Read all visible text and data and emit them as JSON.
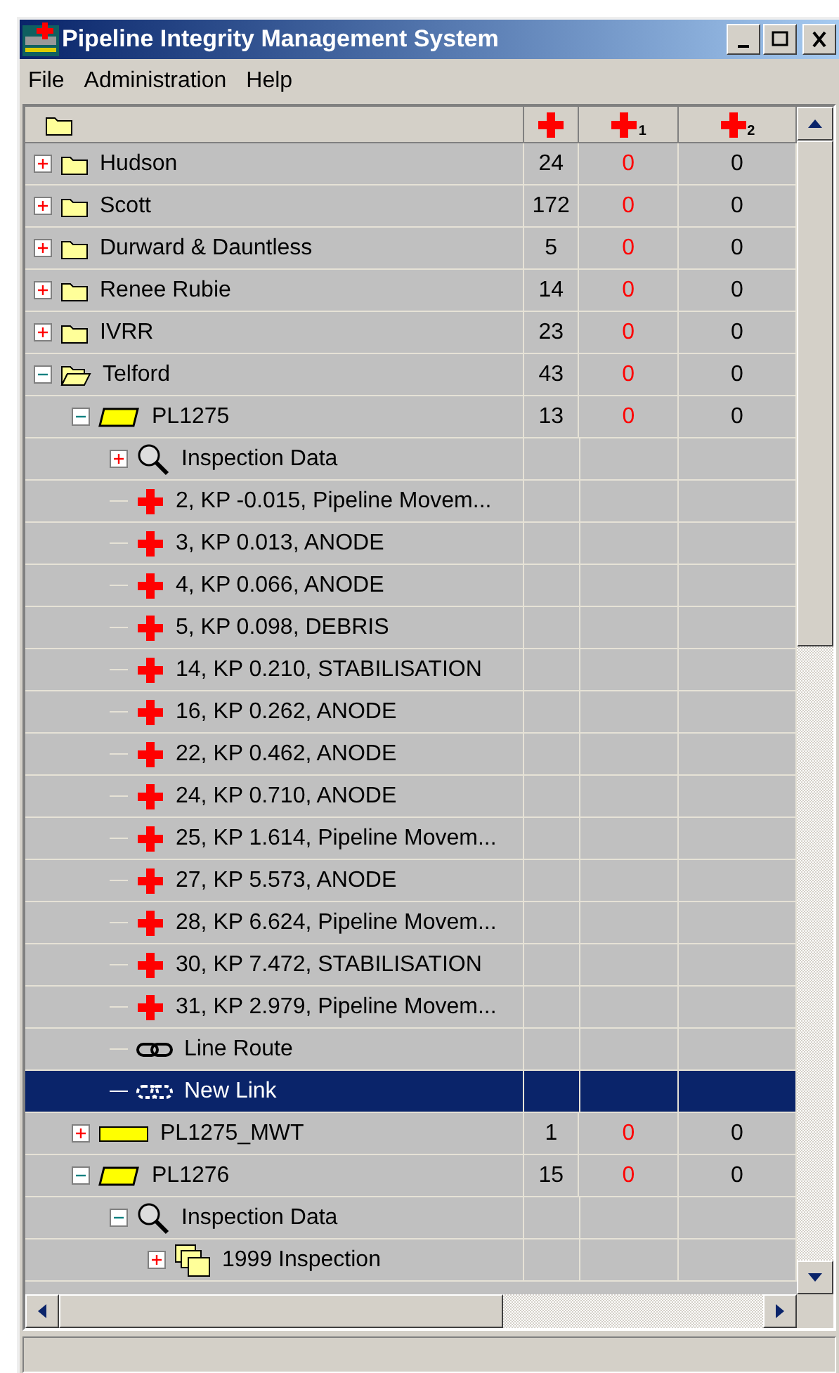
{
  "window": {
    "title": "Pipeline Integrity Management System"
  },
  "menu": [
    "File",
    "Administration",
    "Help"
  ],
  "columns": [
    {
      "kind": "total"
    },
    {
      "kind": "level",
      "subscript": "1"
    },
    {
      "kind": "level",
      "subscript": "2"
    }
  ],
  "tree": [
    {
      "kind": "folder",
      "label": "Hudson",
      "expanded": false,
      "selected": false,
      "total": "24",
      "c1": "0",
      "c2": "0"
    },
    {
      "kind": "folder",
      "label": "Scott",
      "expanded": false,
      "selected": false,
      "total": "172",
      "c1": "0",
      "c2": "0"
    },
    {
      "kind": "folder",
      "label": "Durward & Dauntless",
      "expanded": false,
      "selected": false,
      "total": "5",
      "c1": "0",
      "c2": "0"
    },
    {
      "kind": "folder",
      "label": "Renee Rubie",
      "expanded": false,
      "selected": false,
      "total": "14",
      "c1": "0",
      "c2": "0"
    },
    {
      "kind": "folder",
      "label": "IVRR",
      "expanded": false,
      "selected": false,
      "total": "23",
      "c1": "0",
      "c2": "0"
    },
    {
      "kind": "folder",
      "label": "Telford",
      "expanded": true,
      "selected": false,
      "total": "43",
      "c1": "0",
      "c2": "0",
      "children": [
        {
          "kind": "pipeline",
          "label": "PL1275",
          "expanded": true,
          "selected": false,
          "total": "13",
          "c1": "0",
          "c2": "0",
          "children": [
            {
              "kind": "inspection",
              "label": "Inspection Data",
              "expanded": false,
              "selected": false
            },
            {
              "kind": "anomaly",
              "label": "2, KP -0.015, Pipeline Movem...",
              "selected": false
            },
            {
              "kind": "anomaly",
              "label": "3, KP 0.013, ANODE",
              "selected": false
            },
            {
              "kind": "anomaly",
              "label": "4, KP 0.066, ANODE",
              "selected": false
            },
            {
              "kind": "anomaly",
              "label": "5, KP 0.098, DEBRIS",
              "selected": false
            },
            {
              "kind": "anomaly",
              "label": "14, KP 0.210, STABILISATION",
              "selected": false
            },
            {
              "kind": "anomaly",
              "label": "16, KP 0.262, ANODE",
              "selected": false
            },
            {
              "kind": "anomaly",
              "label": "22, KP 0.462, ANODE",
              "selected": false
            },
            {
              "kind": "anomaly",
              "label": "24, KP 0.710, ANODE",
              "selected": false
            },
            {
              "kind": "anomaly",
              "label": "25, KP 1.614, Pipeline Movem...",
              "selected": false
            },
            {
              "kind": "anomaly",
              "label": "27, KP 5.573, ANODE",
              "selected": false
            },
            {
              "kind": "anomaly",
              "label": "28, KP 6.624, Pipeline Movem...",
              "selected": false
            },
            {
              "kind": "anomaly",
              "label": "30, KP 7.472, STABILISATION",
              "selected": false
            },
            {
              "kind": "anomaly",
              "label": "31, KP 2.979, Pipeline Movem...",
              "selected": false
            },
            {
              "kind": "link",
              "label": "Line Route",
              "selected": false
            },
            {
              "kind": "new-link",
              "label": "New Link",
              "selected": true
            }
          ]
        },
        {
          "kind": "pipeline-flat",
          "label": "PL1275_MWT",
          "expanded": false,
          "selected": false,
          "total": "1",
          "c1": "0",
          "c2": "0"
        },
        {
          "kind": "pipeline",
          "label": "PL1276",
          "expanded": true,
          "selected": false,
          "total": "15",
          "c1": "0",
          "c2": "0",
          "children": [
            {
              "kind": "inspection",
              "label": "Inspection Data",
              "expanded": true,
              "selected": false,
              "children": [
                {
                  "kind": "inspections",
                  "label": "1999 Inspection",
                  "expanded": false,
                  "selected": false
                }
              ]
            }
          ]
        }
      ]
    }
  ]
}
